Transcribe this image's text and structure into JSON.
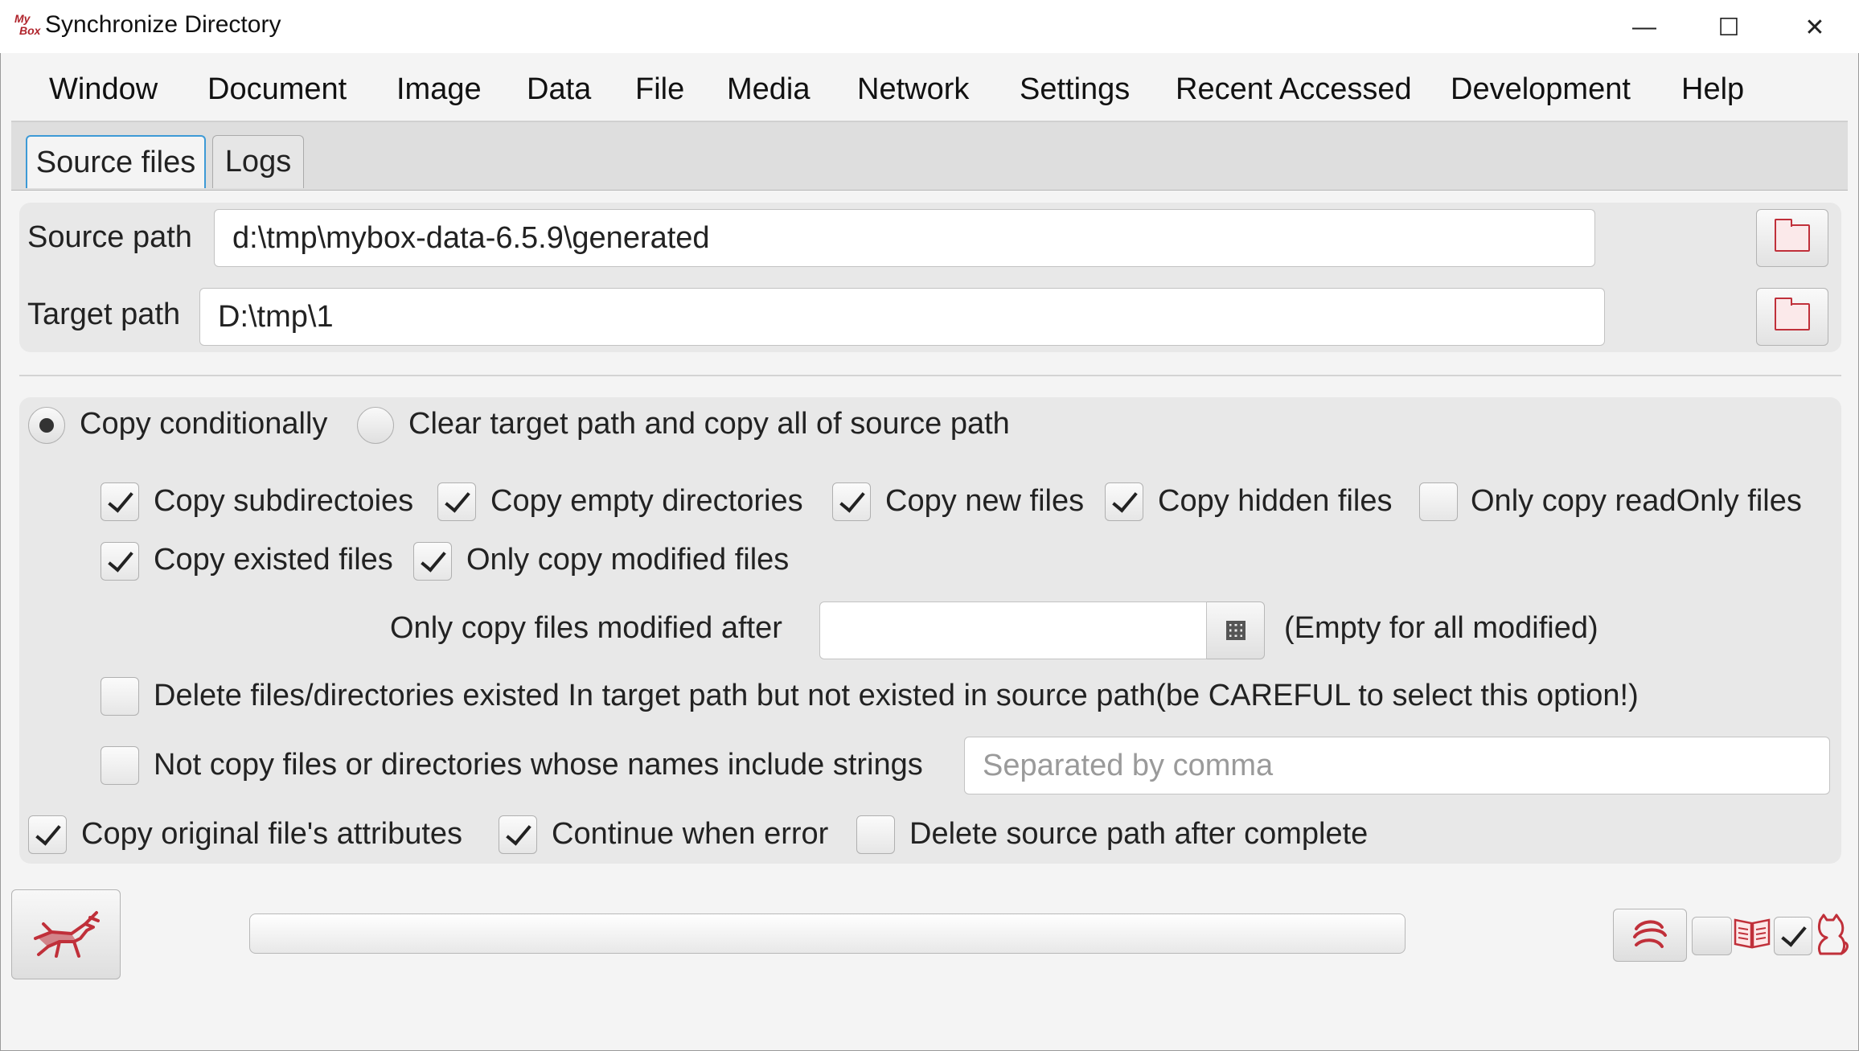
{
  "window": {
    "title": "Synchronize Directory",
    "logo_text_top": "My",
    "logo_text_bottom": "Box",
    "controls": {
      "minimize": "—",
      "maximize": "☐",
      "close": "✕"
    }
  },
  "menu": [
    "Window",
    "Document",
    "Image",
    "Data",
    "File",
    "Media",
    "Network",
    "Settings",
    "Recent Accessed",
    "Development",
    "Help"
  ],
  "tabs": {
    "source_files": "Source files",
    "logs": "Logs",
    "active": "Source files"
  },
  "paths": {
    "source_label": "Source path",
    "source_value": "d:\\tmp\\mybox-data-6.5.9\\generated",
    "target_label": "Target path",
    "target_value": "D:\\tmp\\1"
  },
  "mode": {
    "copy_conditionally": "Copy conditionally",
    "clear_and_copy": "Clear target path and copy all of source path",
    "selected": "copy_conditionally"
  },
  "options": {
    "copy_subdirectories": {
      "label": "Copy subdirectoies",
      "checked": true
    },
    "copy_empty_directories": {
      "label": "Copy empty directories",
      "checked": true
    },
    "copy_new_files": {
      "label": "Copy new files",
      "checked": true
    },
    "copy_hidden_files": {
      "label": "Copy hidden files",
      "checked": true
    },
    "only_copy_readonly": {
      "label": "Only copy readOnly files",
      "checked": false
    },
    "copy_existed_files": {
      "label": "Copy existed files",
      "checked": true
    },
    "only_copy_modified": {
      "label": "Only copy modified files",
      "checked": true
    },
    "modified_after_label": "Only copy files modified after",
    "modified_after_value": "",
    "modified_after_hint": "(Empty for all modified)",
    "delete_not_in_source": {
      "label": "Delete files/directories existed In target path but not existed in source path(be CAREFUL to select this option!)",
      "checked": false
    },
    "not_copy_names": {
      "label": "Not copy files or directories whose names include strings",
      "checked": false,
      "placeholder": "Separated by comma"
    },
    "copy_attributes": {
      "label": "Copy original file's attributes",
      "checked": true
    },
    "continue_on_error": {
      "label": "Continue when error",
      "checked": true
    },
    "delete_source_after": {
      "label": "Delete source path after complete",
      "checked": false
    }
  },
  "bottom": {
    "progress": 0,
    "trailing_checkbox_checked": true,
    "icons": [
      "start-horse-icon",
      "swirl-icon",
      "book-icon",
      "cat-icon"
    ],
    "accent_color": "#c0303a"
  }
}
